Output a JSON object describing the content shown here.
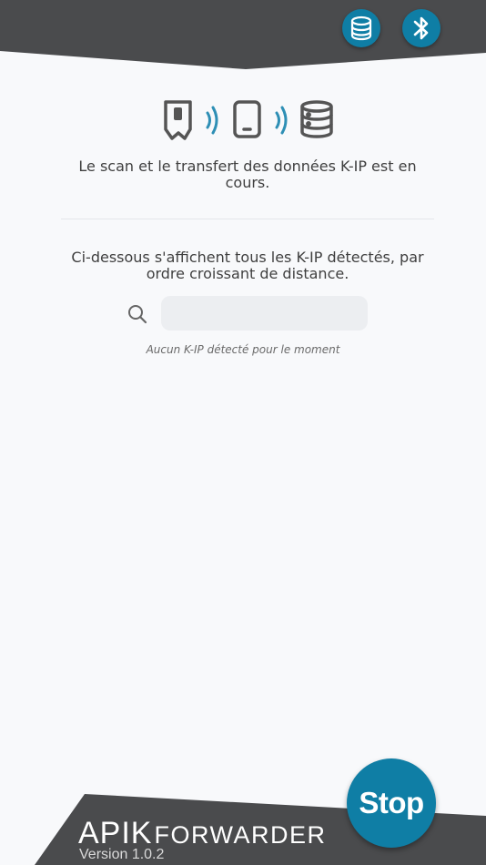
{
  "header": {
    "database_button_icon": "database-icon",
    "bluetooth_button_icon": "bluetooth-icon"
  },
  "status": {
    "icons": [
      "tag-device-icon",
      "signal-waves-icon",
      "phone-icon",
      "signal-waves-icon",
      "database-icon"
    ],
    "scan_message": "Le scan et le transfert des données K-IP est en cours."
  },
  "detected_list": {
    "description": "Ci-dessous s'affichent tous les K-IP détectés, par ordre croissant de distance.",
    "search": {
      "value": "",
      "placeholder": ""
    },
    "empty_message": "Aucun K-IP détecté pour le moment"
  },
  "footer": {
    "stop_label": "Stop",
    "brand_main": "APIK",
    "brand_sub": "FORWARDER",
    "version": "Version 1.0.2"
  },
  "colors": {
    "accent": "#0f7ea5",
    "header_dark": "#4a4b4d",
    "icon_gray": "#555555",
    "wave_blue": "#2e8fb5",
    "background": "#f8f9fb"
  }
}
